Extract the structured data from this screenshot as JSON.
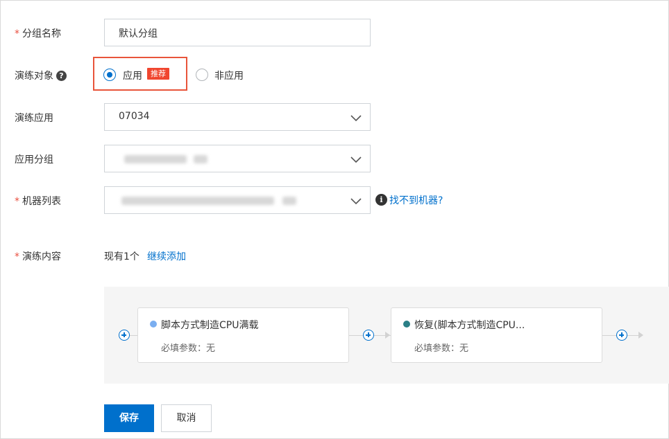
{
  "form": {
    "group_name": {
      "required_mark": "*",
      "label": "分组名称",
      "value": "默认分组"
    },
    "drill_target": {
      "label": "演练对象",
      "help_icon": "question-circle-icon",
      "options": [
        {
          "label": "应用",
          "selected": true,
          "tag": "推荐"
        },
        {
          "label": "非应用",
          "selected": false
        }
      ],
      "highlight_color": "#e8543a"
    },
    "drill_app": {
      "label": "演练应用",
      "value": "07034"
    },
    "app_group": {
      "label": "应用分组",
      "value": ""
    },
    "machine_list": {
      "required_mark": "*",
      "label": "机器列表",
      "value": "",
      "help_link": "找不到机器?"
    },
    "drill_content": {
      "required_mark": "*",
      "label": "演练内容",
      "count_text": "现有1个",
      "add_link": "继续添加"
    }
  },
  "flow": {
    "nodes": [
      {
        "title": "脚本方式制造CPU满载",
        "params": "必填参数：无",
        "dot_color": "#7aaef0"
      },
      {
        "title": "恢复(脚本方式制造CPU...",
        "params": "必填参数：无",
        "dot_color": "#2a7f86"
      }
    ]
  },
  "buttons": {
    "save": "保存",
    "cancel": "取消"
  },
  "colors": {
    "primary": "#0070cc",
    "required": "#e94f3f",
    "tag": "#f0462f"
  }
}
